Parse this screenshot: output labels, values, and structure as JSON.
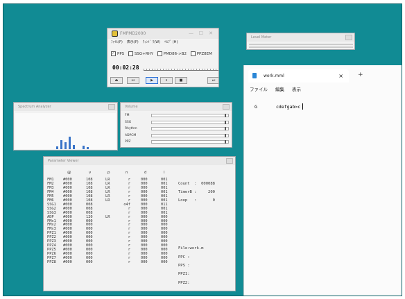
{
  "fmp": {
    "title": "FMPMD2000",
    "menu": [
      "ﾌｧｲﾙ(F)",
      "表示(P)",
      "ｳｨﾝﾄﾞ ｳ(W)",
      "ﾍﾙﾌﾟ (H)"
    ],
    "checks": [
      {
        "label": "PPS",
        "checked": true
      },
      {
        "label": "SSG+RHY",
        "checked": false
      },
      {
        "label": "PMD86->B2",
        "checked": false
      },
      {
        "label": "PPZ8EM",
        "checked": false
      }
    ],
    "timer": "00:02:28",
    "seek_position": 0.92,
    "controls": [
      "eject-icon",
      "previous-icon",
      "play-icon",
      "pause-icon",
      "stop-icon",
      "next-icon"
    ],
    "control_glyphs": [
      "⏏",
      "⏮",
      "▶",
      "⏸",
      "■",
      "⏭"
    ]
  },
  "level_meter": {
    "title": "Level Meter"
  },
  "spectrum": {
    "title": "Spectrum Analyzer",
    "bars": [
      {
        "x": 0.45,
        "h": 0.7
      },
      {
        "x": 0.49,
        "h": 0.55
      },
      {
        "x": 0.53,
        "h": 1.0
      },
      {
        "x": 0.57,
        "h": 0.35
      },
      {
        "x": 0.41,
        "h": 0.25
      },
      {
        "x": 0.67,
        "h": 0.3
      },
      {
        "x": 0.71,
        "h": 0.15
      }
    ]
  },
  "volume": {
    "title": "Volume",
    "rows": [
      {
        "label": "FM",
        "value": "0",
        "level": 0.97
      },
      {
        "label": "SSG",
        "value": "0",
        "level": 0.97
      },
      {
        "label": "Rhythm",
        "value": "0",
        "level": 0.97
      },
      {
        "label": "ADPCM",
        "value": "0",
        "level": 0.97
      },
      {
        "label": "PPZ",
        "value": "0",
        "level": 0.97
      }
    ]
  },
  "param": {
    "title": "Parameter Viewer",
    "headers": [
      "@",
      "v",
      "p",
      "n",
      "d",
      "l"
    ],
    "channels": "FM1\nFM2\nFM3\nFM4\nFM5\nFM6\nSSG1\nSSG2\nSSG3\nADP\nFMx1\nFMx2\nFMx3\nPPZ1\nPPZ2\nPPZ3\nPPZ4\nPPZ5\nPPZ6\nPPZ7\nPPZ8",
    "at": "#000\n#000\n#000\n#000\n#000\n#000\n#000\n#000\n#000\n#000\n#000\n#000\n#000\n#000\n#000\n#000\n#000\n#000\n#000\n#000\n#000",
    "v": "108\n108\n108\n108\n108\n108\n008\n008\n008\n120\n000\n000\n000\n000\n000\n000\n000\n000\n000\n000\n000",
    "p": "LR\nLR\nLR\nLR\nLR\nLR\n\n\n\nLR\n\n\n\n\n\n\n\n\n\n\n",
    "n": "r\nr\nr\nr\nr\nr\no4f\nr\nr\nr\nr\nr\nr\nr\nr\nr\nr\nr\nr\nr\nr",
    "d": "000\n000\n000\n000\n000\n000\n000\n000\n000\n000\n000\n000\n000\n000\n000\n000\n000\n000\n000\n000\n000",
    "l": "001\n001\n001\n001\n001\n001\n011\n001\n001\n000\n000\n000\n000\n000\n000\n000\n000\n000\n000\n000\n000",
    "count": "Count  :  000088",
    "timerb": "TimerB :     200",
    "loop": "Loop   :       0",
    "file": "File:work.m",
    "ppc": "PPC :",
    "pps": "PPS :",
    "ppz1": "PPZ1:",
    "ppz2": "PPZ2:"
  },
  "notepad": {
    "tab": "work.mml",
    "close": "×",
    "plus": "+",
    "menu": [
      "ファイル",
      "編集",
      "表示"
    ],
    "line_g": "G",
    "line_text": "cdefgab>c"
  }
}
